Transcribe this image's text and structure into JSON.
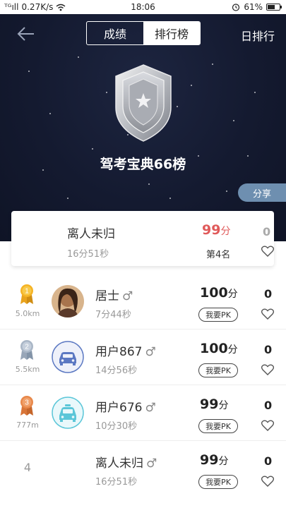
{
  "status_bar": {
    "signal": "ᵀᴳıll",
    "speed": "0.27K/s",
    "wifi_icon": "wifi-icon",
    "time": "18:06",
    "alarm_icon": "alarm-icon",
    "battery": "61%",
    "battery_level": 0.61
  },
  "header": {
    "tabs": [
      {
        "label": "成绩",
        "active": false
      },
      {
        "label": "排行榜",
        "active": true
      }
    ],
    "day_rank_label": "日排行",
    "title": "驾考宝典66榜",
    "share_label": "分享"
  },
  "my_card": {
    "name": "离人未归",
    "time": "16分51秒",
    "score": "99",
    "score_unit": "分",
    "position": "第4名",
    "likes": "0"
  },
  "rankings": [
    {
      "rank": "1",
      "medal": "gold",
      "distance": "5.0km",
      "name": "居士",
      "gender": "♂",
      "time": "7分44秒",
      "score": "100",
      "unit": "分",
      "pk": "我要PK",
      "likes": "0",
      "avatar": "photo"
    },
    {
      "rank": "2",
      "medal": "silver",
      "distance": "5.5km",
      "name": "用户867",
      "gender": "♂",
      "time": "14分56秒",
      "score": "100",
      "unit": "分",
      "pk": "我要PK",
      "likes": "0",
      "avatar": "car-sedan"
    },
    {
      "rank": "3",
      "medal": "bronze",
      "distance": "777m",
      "name": "用户676",
      "gender": "♂",
      "time": "10分30秒",
      "score": "99",
      "unit": "分",
      "pk": "我要PK",
      "likes": "0",
      "avatar": "car-taxi"
    },
    {
      "rank": "4",
      "medal": "none",
      "distance": "",
      "name": "离人未归",
      "gender": "♂",
      "time": "16分51秒",
      "score": "99",
      "unit": "分",
      "pk": "我要PK",
      "likes": "0",
      "avatar": "none"
    }
  ],
  "colors": {
    "header_bg": "#141a30",
    "my_score": "#e05a5a",
    "share_bg": "#6e8fb0",
    "gold": "#f5b324",
    "silver": "#a9b6c6",
    "bronze": "#e8884a",
    "avatar_car_blue": "#5b78c2",
    "avatar_car_teal": "#5bc6d8"
  }
}
